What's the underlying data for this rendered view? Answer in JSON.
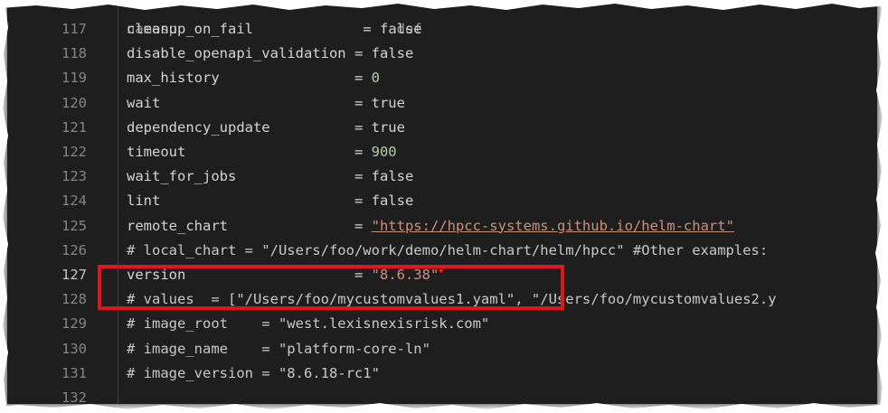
{
  "editor": {
    "header_fragment": "namesp                          def",
    "lines": [
      {
        "num": "117",
        "key": "cleanup_on_fail",
        "pad": "             ",
        "op": "= ",
        "val": "false",
        "type": "kw"
      },
      {
        "num": "118",
        "key": "disable_openapi_validation",
        "pad": " ",
        "op": "= ",
        "val": "false",
        "type": "kw"
      },
      {
        "num": "119",
        "key": "max_history",
        "pad": "                ",
        "op": "= ",
        "val": "0",
        "type": "num"
      },
      {
        "num": "120",
        "key": "wait",
        "pad": "                       ",
        "op": "= ",
        "val": "true",
        "type": "kw"
      },
      {
        "num": "121",
        "key": "dependency_update",
        "pad": "          ",
        "op": "= ",
        "val": "true",
        "type": "kw"
      },
      {
        "num": "122",
        "key": "timeout",
        "pad": "                    ",
        "op": "= ",
        "val": "900",
        "type": "num"
      },
      {
        "num": "123",
        "key": "wait_for_jobs",
        "pad": "              ",
        "op": "= ",
        "val": "false",
        "type": "kw"
      },
      {
        "num": "124",
        "key": "lint",
        "pad": "                       ",
        "op": "= ",
        "val": "false",
        "type": "kw"
      },
      {
        "num": "125",
        "key": "remote_chart",
        "pad": "               ",
        "op": "= ",
        "val": "\"https://hpcc-systems.github.io/helm-chart\"",
        "type": "url"
      },
      {
        "num": "126",
        "text": "# local_chart = \"/Users/foo/work/demo/helm-chart/helm/hpcc\" #Other examples:",
        "type": "cmt"
      },
      {
        "num": "127",
        "key": "version",
        "pad": "                    ",
        "op": "= ",
        "val": "\"8.6.38\"",
        "type": "str",
        "active": true
      },
      {
        "num": "128",
        "text": "# values  = [\"/Users/foo/mycustomvalues1.yaml\", \"/Users/foo/mycustomvalues2.y",
        "type": "cmt"
      },
      {
        "num": "129",
        "text": "# image_root    = \"west.lexisnexisrisk.com\"",
        "type": "cmt"
      },
      {
        "num": "130",
        "text": "# image_name    = \"platform-core-ln\"",
        "type": "cmt"
      },
      {
        "num": "131",
        "text": "# image_version = \"8.6.18-rc1\"",
        "type": "cmt"
      },
      {
        "num": "132",
        "text": "",
        "type": "cmt"
      }
    ]
  },
  "colors": {
    "background": "#1e1e1e",
    "line_number": "#858585",
    "text": "#d4d4d4",
    "string": "#ce9178",
    "number": "#b5cea8",
    "highlight_border": "#e0141c"
  }
}
